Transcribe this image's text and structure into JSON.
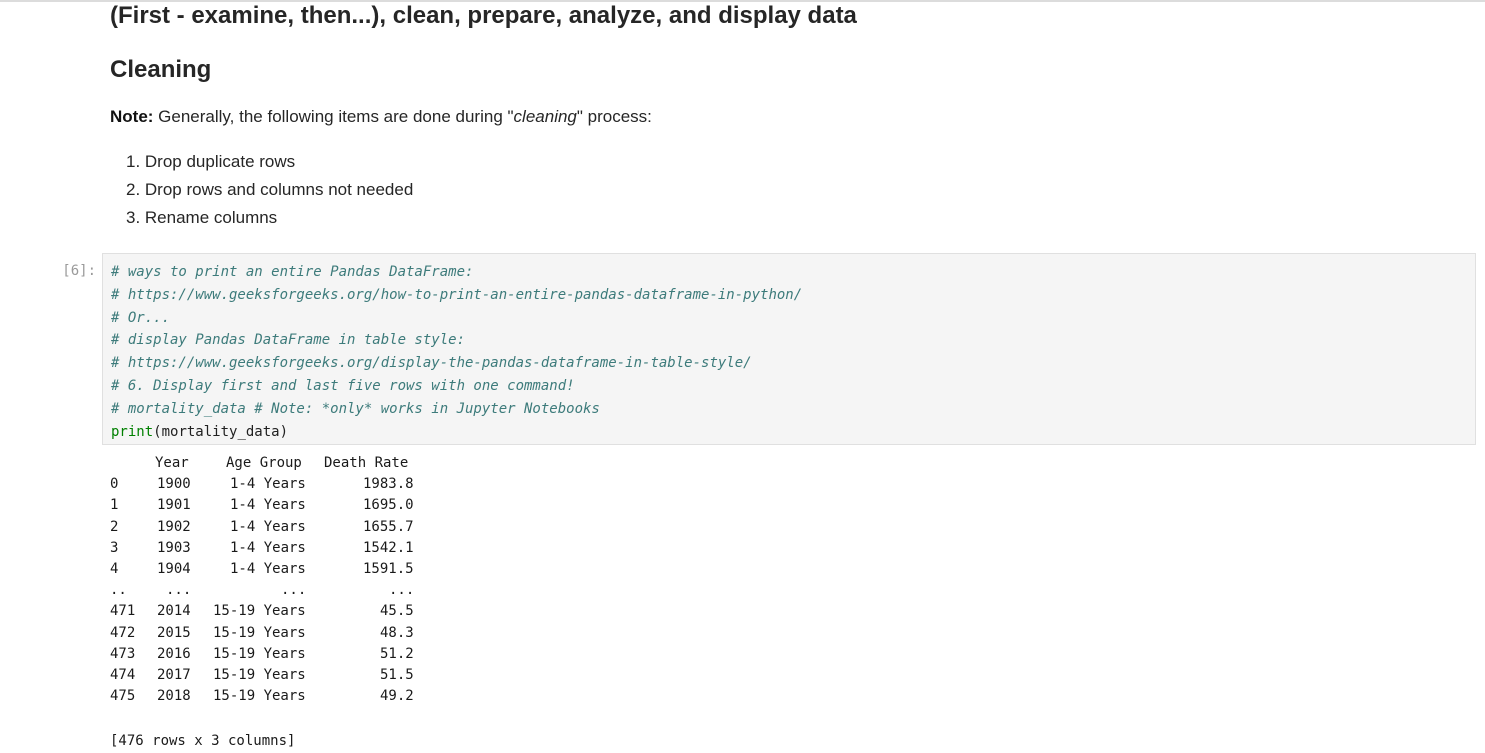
{
  "markdown": {
    "heading_main": "(First - examine, then...), clean, prepare, analyze, and display data",
    "heading_cleaning": "Cleaning",
    "note_label": "Note:",
    "note_text_before": " Generally, the following items are done during \"",
    "note_italic": "cleaning",
    "note_text_after": "\" process:",
    "steps": [
      "1. Drop duplicate rows",
      "2. Drop rows and columns not needed",
      "3. Rename columns"
    ]
  },
  "code_cell": {
    "prompt": "[6]:",
    "comment_lines": [
      "# ways to print an entire Pandas DataFrame:",
      "# https://www.geeksforgeeks.org/how-to-print-an-entire-pandas-dataframe-in-python/",
      "# Or...",
      "# display Pandas DataFrame in table style:",
      "# https://www.geeksforgeeks.org/display-the-pandas-dataframe-in-table-style/",
      "# 6. Display first and last five rows with one command!",
      "# mortality_data # Note: *only* works in Jupyter Notebooks"
    ],
    "code_fn": "print",
    "code_args": "(mortality_data)"
  },
  "output": {
    "headers": [
      "Year",
      "Age Group",
      "Death Rate"
    ],
    "rows": [
      [
        "0",
        "1900",
        "1-4 Years",
        "1983.8"
      ],
      [
        "1",
        "1901",
        "1-4 Years",
        "1695.0"
      ],
      [
        "2",
        "1902",
        "1-4 Years",
        "1655.7"
      ],
      [
        "3",
        "1903",
        "1-4 Years",
        "1542.1"
      ],
      [
        "4",
        "1904",
        "1-4 Years",
        "1591.5"
      ],
      [
        "..",
        "...",
        "...",
        "..."
      ],
      [
        "471",
        "2014",
        "15-19 Years",
        "45.5"
      ],
      [
        "472",
        "2015",
        "15-19 Years",
        "48.3"
      ],
      [
        "473",
        "2016",
        "15-19 Years",
        "51.2"
      ],
      [
        "474",
        "2017",
        "15-19 Years",
        "51.5"
      ],
      [
        "475",
        "2018",
        "15-19 Years",
        "49.2"
      ]
    ],
    "summary": "[476 rows x 3 columns]"
  }
}
